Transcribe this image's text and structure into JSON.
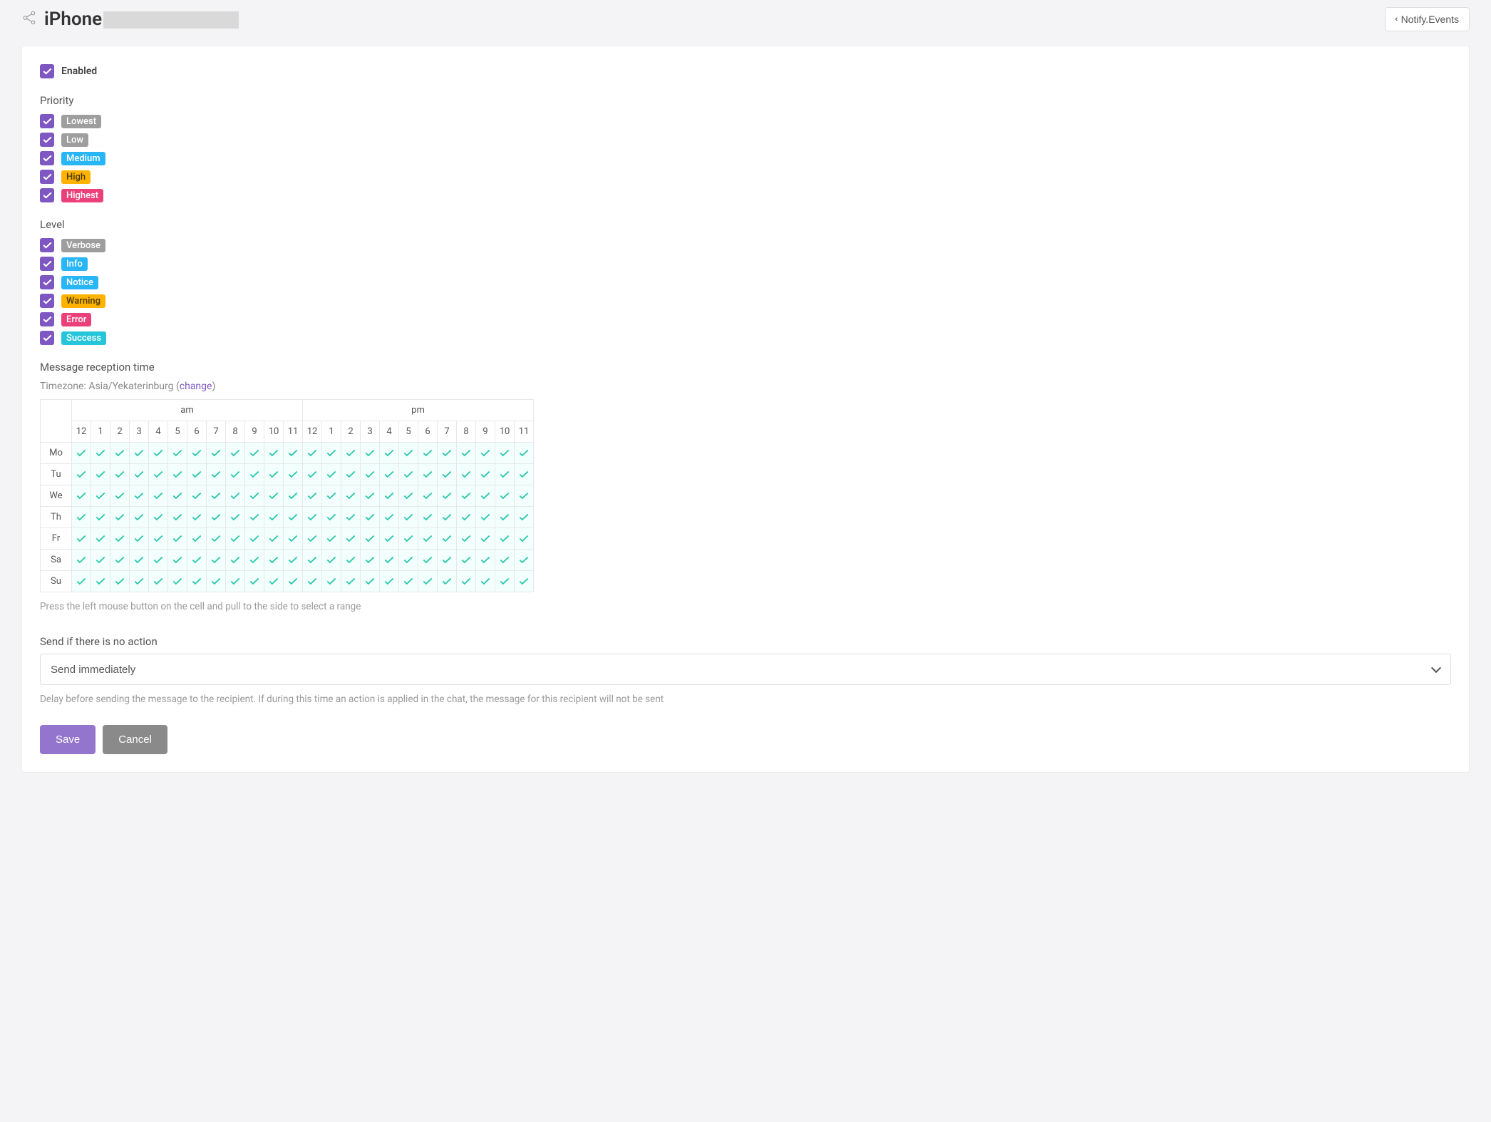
{
  "header": {
    "title_prefix": "iPhone",
    "back_label": "Notify.Events"
  },
  "enabled": {
    "label": "Enabled",
    "checked": true
  },
  "priority": {
    "label": "Priority",
    "items": [
      {
        "label": "Lowest",
        "color": "gray",
        "checked": true
      },
      {
        "label": "Low",
        "color": "gray",
        "checked": true
      },
      {
        "label": "Medium",
        "color": "blue",
        "checked": true
      },
      {
        "label": "High",
        "color": "amber",
        "checked": true
      },
      {
        "label": "Highest",
        "color": "pink",
        "checked": true
      }
    ]
  },
  "level": {
    "label": "Level",
    "items": [
      {
        "label": "Verbose",
        "color": "gray",
        "checked": true
      },
      {
        "label": "Info",
        "color": "blue",
        "checked": true
      },
      {
        "label": "Notice",
        "color": "blue",
        "checked": true
      },
      {
        "label": "Warning",
        "color": "amber",
        "checked": true
      },
      {
        "label": "Error",
        "color": "pink",
        "checked": true
      },
      {
        "label": "Success",
        "color": "teal",
        "checked": true
      }
    ]
  },
  "schedule": {
    "label": "Message reception time",
    "timezone_prefix": "Timezone: ",
    "timezone": "Asia/Yekaterinburg",
    "change_label": "change",
    "periods": [
      "am",
      "pm"
    ],
    "hours": [
      "12",
      "1",
      "2",
      "3",
      "4",
      "5",
      "6",
      "7",
      "8",
      "9",
      "10",
      "11"
    ],
    "days": [
      "Mo",
      "Tu",
      "We",
      "Th",
      "Fr",
      "Sa",
      "Su"
    ],
    "hint": "Press the left mouse button on the cell and pull to the side to select a range"
  },
  "delay": {
    "label": "Send if there is no action",
    "value": "Send immediately",
    "hint": "Delay before sending the message to the recipient. If during this time an action is applied in the chat, the message for this recipient will not be sent"
  },
  "buttons": {
    "save": "Save",
    "cancel": "Cancel"
  }
}
